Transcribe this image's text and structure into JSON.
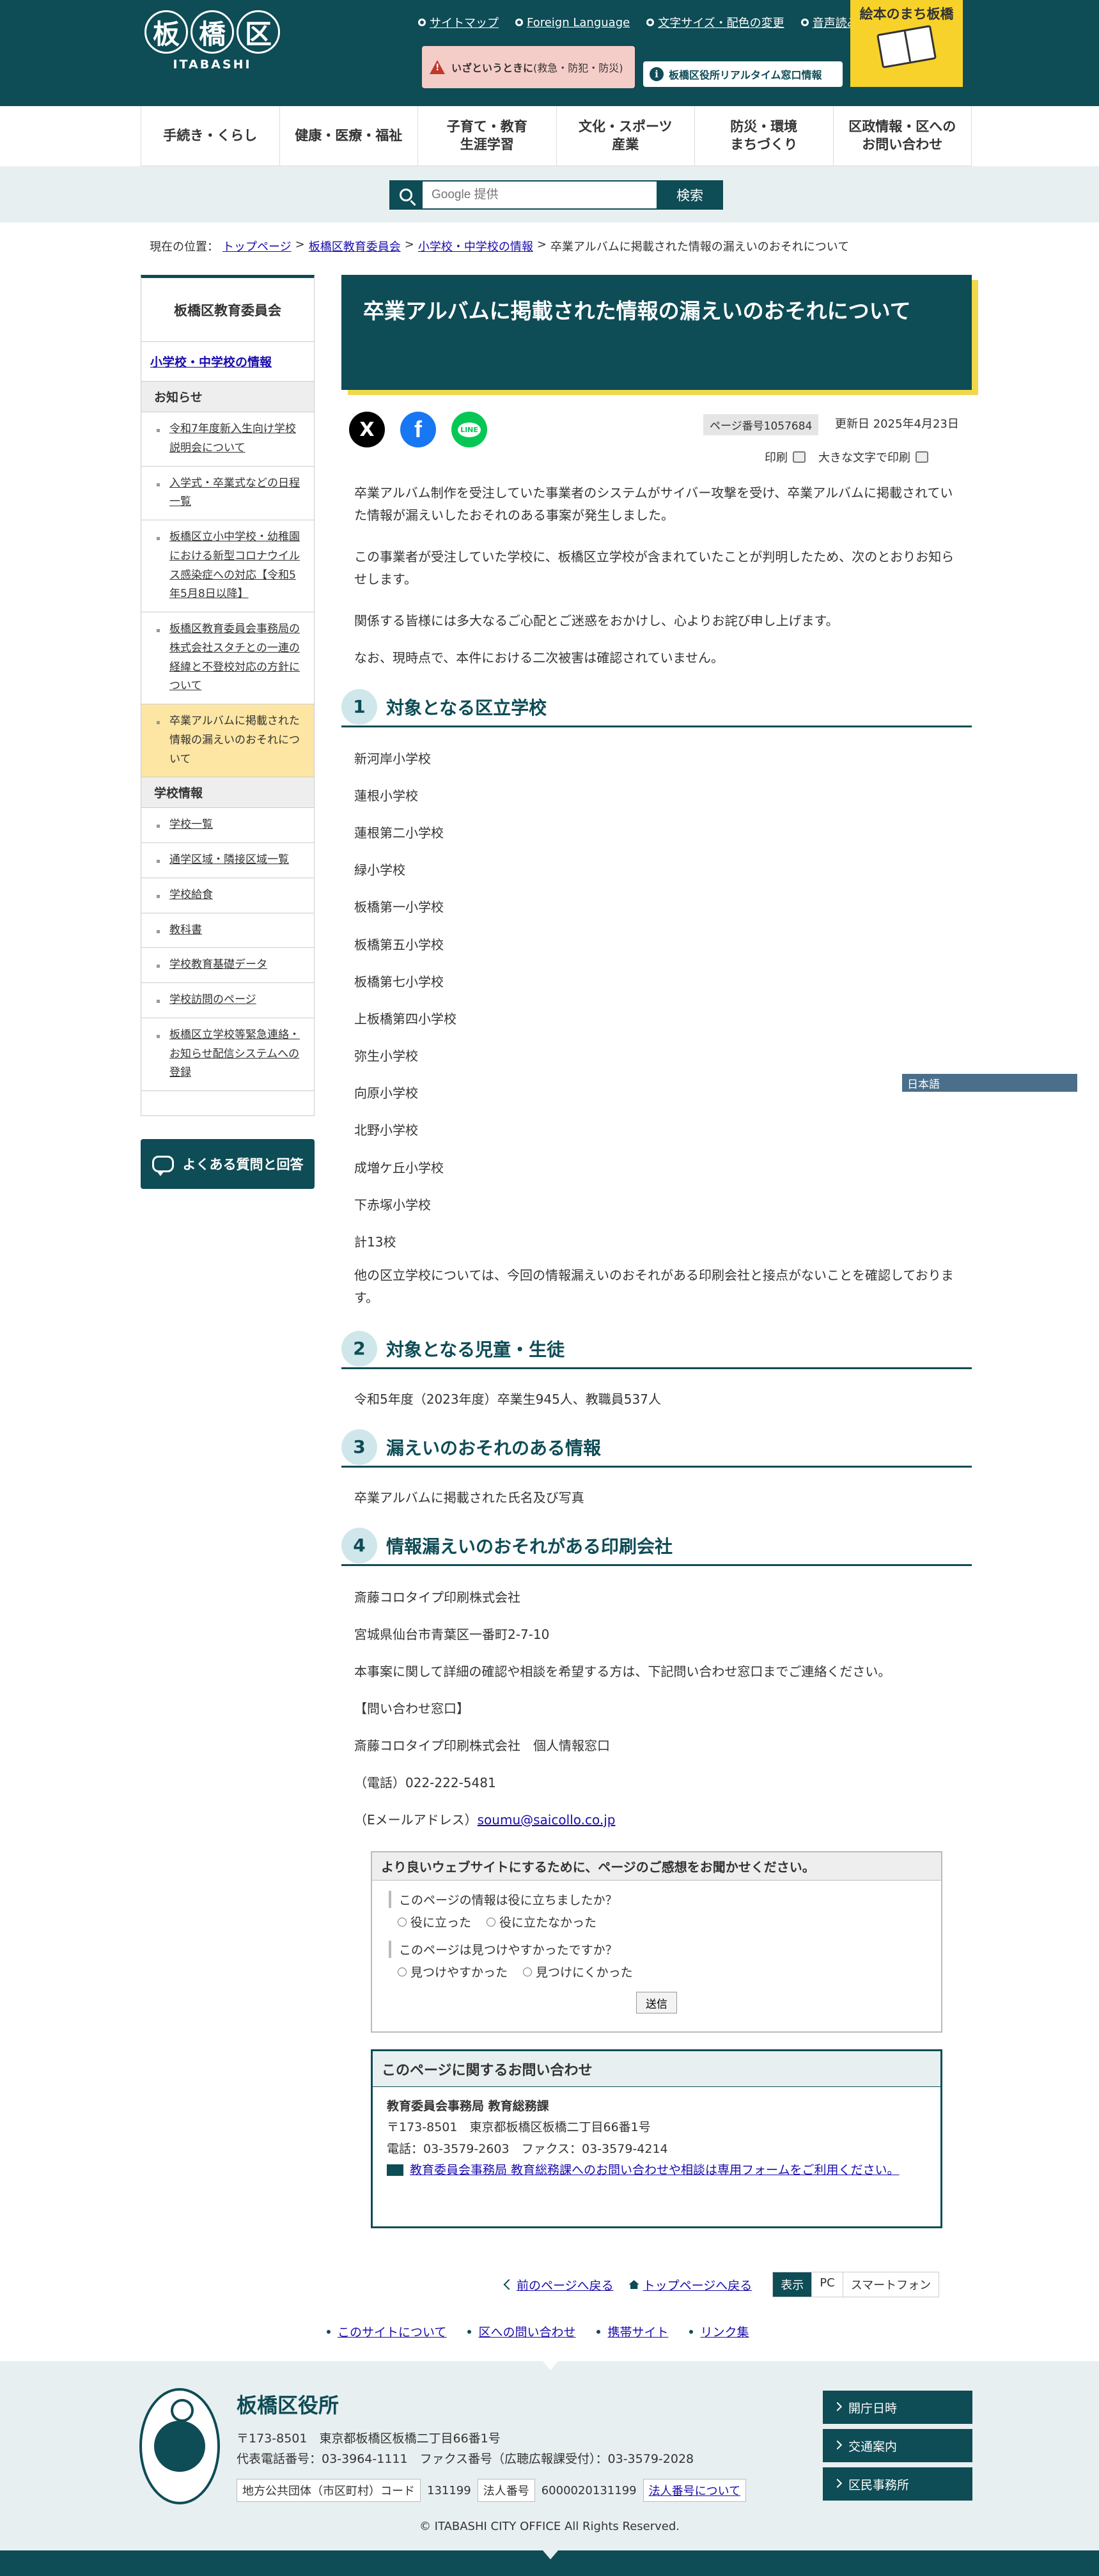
{
  "header": {
    "logo_kanji": [
      "板",
      "橋",
      "区"
    ],
    "logo_roman": "ITABASHI",
    "utility_links": [
      "サイトマップ",
      "Foreign Language",
      "文字サイズ・配色の変更",
      "音声読み上げ・ふりがな"
    ],
    "emergency_bold": "いざというときに",
    "emergency_text": "(救急・防犯・防災)",
    "window_info": "板橋区役所リアルタイム窓口情報",
    "picture_book": "絵本のまち板橋"
  },
  "gnav": [
    "手続き・くらし",
    "健康・医療・福祉",
    "子育て・教育\n生涯学習",
    "文化・スポーツ\n産業",
    "防災・環境\nまちづくり",
    "区政情報・区への\nお問い合わせ"
  ],
  "search": {
    "placeholder": "Google 提供",
    "button": "検索"
  },
  "breadcrumb": {
    "prefix": "現在の位置：",
    "items": [
      "トップページ",
      "板橋区教育委員会",
      "小学校・中学校の情報"
    ],
    "current": "卒業アルバムに掲載された情報の漏えいのおそれについて"
  },
  "sidebar": {
    "title": "板橋区教育委員会",
    "sub": "小学校・中学校の情報",
    "notice_head": "お知らせ",
    "notices": [
      "令和7年度新入生向け学校説明会について",
      "入学式・卒業式などの日程一覧",
      "板橋区立小中学校・幼稚園における新型コロナウイルス感染症への対応【令和5年5月8日以降】",
      "板橋区教育委員会事務局の株式会社スタチとの一連の経緯と不登校対応の方針について",
      "卒業アルバムに掲載された情報の漏えいのおそれについて"
    ],
    "school_head": "学校情報",
    "schools": [
      "学校一覧",
      "通学区域・隣接区域一覧",
      "学校給食",
      "教科書",
      "学校教育基礎データ",
      "学校訪問のページ",
      "板橋区立学校等緊急連絡・お知らせ配信システムへの登録"
    ],
    "faq": "よくある質問と回答"
  },
  "article": {
    "title": "卒業アルバムに掲載された情報の漏えいのおそれについて",
    "share": {
      "x": "X",
      "fb": "f",
      "line": "LINE"
    },
    "page_no": "ページ番号1057684",
    "updated": "更新日 2025年4月23日",
    "print": "印刷",
    "print_large": "大きな文字で印刷",
    "intro": [
      "卒業アルバム制作を受注していた事業者のシステムがサイバー攻撃を受け、卒業アルバムに掲載されていた情報が漏えいしたおそれのある事案が発生しました。",
      "この事業者が受注していた学校に、板橋区立学校が含まれていたことが判明したため、次のとおりお知らせします。",
      "関係する皆様には多大なるご心配とご迷惑をおかけし、心よりお詫び申し上げます。",
      "なお、現時点で、本件における二次被害は確認されていません。"
    ],
    "sections": [
      {
        "num": "1",
        "title": "対象となる区立学校"
      },
      {
        "num": "2",
        "title": "対象となる児童・生徒"
      },
      {
        "num": "3",
        "title": "漏えいのおそれのある情報"
      },
      {
        "num": "4",
        "title": "情報漏えいのおそれがある印刷会社"
      }
    ],
    "schools": [
      "新河岸小学校",
      "蓮根小学校",
      "蓮根第二小学校",
      "緑小学校",
      "板橋第一小学校",
      "板橋第五小学校",
      "板橋第七小学校",
      "上板橋第四小学校",
      "弥生小学校",
      "向原小学校",
      "北野小学校",
      "成増ケ丘小学校",
      "下赤塚小学校",
      "計13校"
    ],
    "other_schools": "他の区立学校については、今回の情報漏えいのおそれがある印刷会社と接点がないことを確認しております。",
    "students": "令和5年度（2023年度）卒業生945人、教職員537人",
    "info": "卒業アルバムに掲載された氏名及び写真",
    "company": "斎藤コロタイプ印刷株式会社",
    "address": "宮城県仙台市青葉区一番町2-7-10",
    "inquiry_note": "本事案に関して詳細の確認や相談を希望する方は、下記問い合わせ窓口までご連絡ください。",
    "window_label": "【問い合わせ窓口】",
    "window_name": "斎藤コロタイプ印刷株式会社　個人情報窓口",
    "tel": "（電話）022-222-5481",
    "mail_label": "（Eメールアドレス）",
    "mail": "soumu@saicollo.co.jp"
  },
  "lang_select": "日本語",
  "survey": {
    "head": "より良いウェブサイトにするために、ページのご感想をお聞かせください。",
    "q1": "このページの情報は役に立ちましたか？",
    "q1_opts": [
      "役に立った",
      "役に立たなかった"
    ],
    "q2": "このページは見つけやすかったですか？",
    "q2_opts": [
      "見つけやすかった",
      "見つけにくかった"
    ],
    "send": "送信"
  },
  "contact": {
    "head": "このページに関するお問い合わせ",
    "dept": "教育委員会事務局 教育総務課",
    "addr": "〒173-8501　東京都板橋区板橋二丁目66番1号",
    "tel": "電話：03-3579-2603　ファクス：03-3579-4214",
    "form": "教育委員会事務局 教育総務課へのお問い合わせや相談は専用フォームをご利用ください。"
  },
  "bottom_links": {
    "back": "前のページへ戻る",
    "top": "トップページへ戻る",
    "display": [
      "表示",
      "PC",
      "スマートフォン"
    ]
  },
  "footer_links": [
    "このサイトについて",
    "区への問い合わせ",
    "携帯サイト",
    "リンク集"
  ],
  "footer": {
    "name": "板橋区役所",
    "addr": "〒173-8501　東京都板橋区板橋二丁目66番1号",
    "tel": "代表電話番号：03-3964-1111　ファクス番号（広聴広報課受付）：03-3579-2028",
    "code_label": "地方公共団体（市区町村）コード",
    "code": "131199",
    "corp_label": "法人番号",
    "corp": "6000020131199",
    "corp_link": "法人番号について",
    "buttons": [
      "開庁日時",
      "交通案内",
      "区民事務所"
    ],
    "copyright": "© ITABASHI CITY OFFICE All Rights Reserved."
  }
}
